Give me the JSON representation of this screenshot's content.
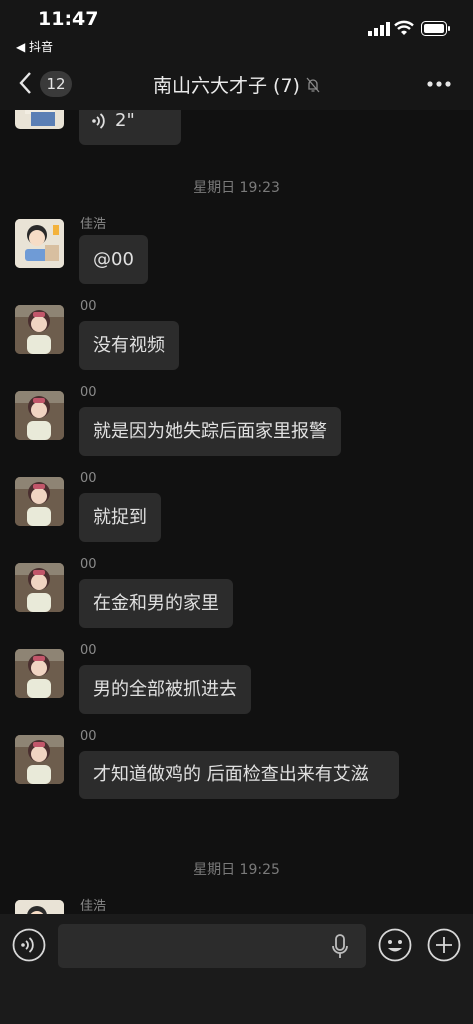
{
  "status_bar": {
    "time": "11:47",
    "back_to_app": "◀ 抖音"
  },
  "nav": {
    "back_badge": "12",
    "title": "南山六大才子 (7)"
  },
  "messages": [
    {
      "sender": "",
      "text": "2\""
    },
    {
      "timestamp": "星期日 19:23"
    },
    {
      "sender": "佳浩",
      "text": "@00"
    },
    {
      "sender": "00",
      "text": "没有视频"
    },
    {
      "sender": "00",
      "text": "就是因为她失踪后面家里报警"
    },
    {
      "sender": "00",
      "text": "就捉到"
    },
    {
      "sender": "00",
      "text": "在金和男的家里"
    },
    {
      "sender": "00",
      "text": "男的全部被抓进去"
    },
    {
      "sender": "00",
      "text": "才知道做鸡的 后面检查出来有艾滋"
    },
    {
      "timestamp": "星期日 19:25"
    },
    {
      "sender": "佳浩",
      "text": ""
    }
  ],
  "input_bar": {
    "value": ""
  },
  "icons": {
    "voice": "voice-message-icon",
    "mic": "microphone-icon",
    "emoji": "emoji-icon",
    "plus": "plus-icon",
    "mute": "muted-bell-icon"
  }
}
